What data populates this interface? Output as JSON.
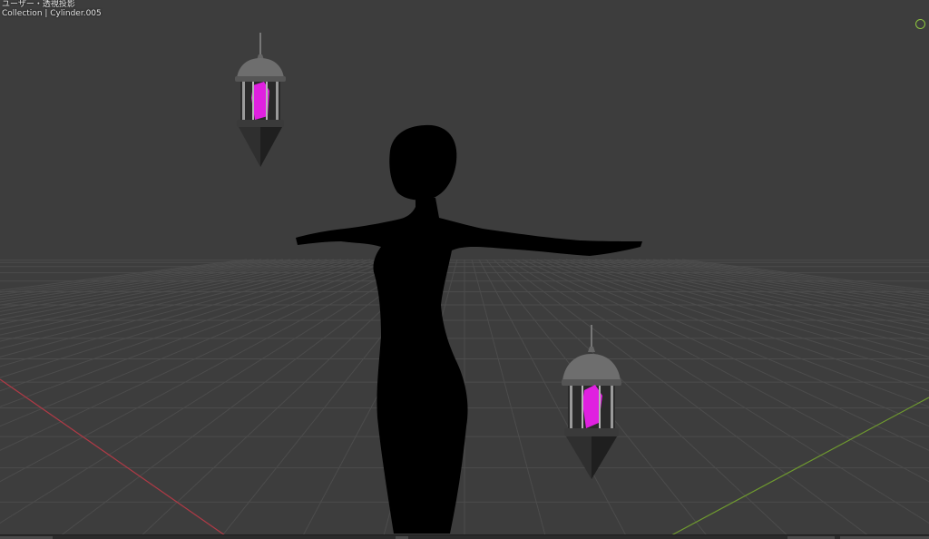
{
  "viewport": {
    "view_mode_label": "ユーザー・透視投影",
    "collection_path": "Collection | Cylinder.005"
  },
  "colors": {
    "background": "#3d3d3d",
    "grid_line": "#4c4c4c",
    "x_axis": "#b03a46",
    "y_axis": "#6f9a2f",
    "crystal": "#e020e0",
    "lantern_metal": "#6e6e6e",
    "silhouette": "#000000"
  },
  "icons": {
    "navigation_gizmo": "circle-icon"
  }
}
